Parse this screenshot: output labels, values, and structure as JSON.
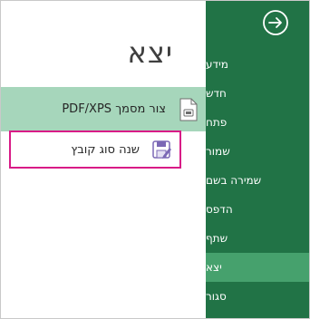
{
  "page": {
    "title": "יצא"
  },
  "export_options": [
    {
      "label": "צור מסמך PDF/XPS",
      "icon": "pdf-document-icon",
      "selected": true
    },
    {
      "label": "שנה סוג קובץ",
      "icon": "change-file-type-icon",
      "selected": false,
      "highlighted": true
    }
  ],
  "sidebar": {
    "back_icon": "back-arrow-icon",
    "items": [
      {
        "label": "מידע"
      },
      {
        "label": "חדש"
      },
      {
        "label": "פתח"
      },
      {
        "label": "שמור"
      },
      {
        "label": "שמירה בשם"
      },
      {
        "label": "הדפס"
      },
      {
        "label": "שתף"
      },
      {
        "label": "יצא",
        "active": true
      },
      {
        "label": "סגור"
      }
    ]
  },
  "colors": {
    "sidebar_bg": "#217346",
    "sidebar_active": "#46a16d",
    "selected_tile": "#a6d6bb",
    "highlight_border": "#d81b87"
  }
}
